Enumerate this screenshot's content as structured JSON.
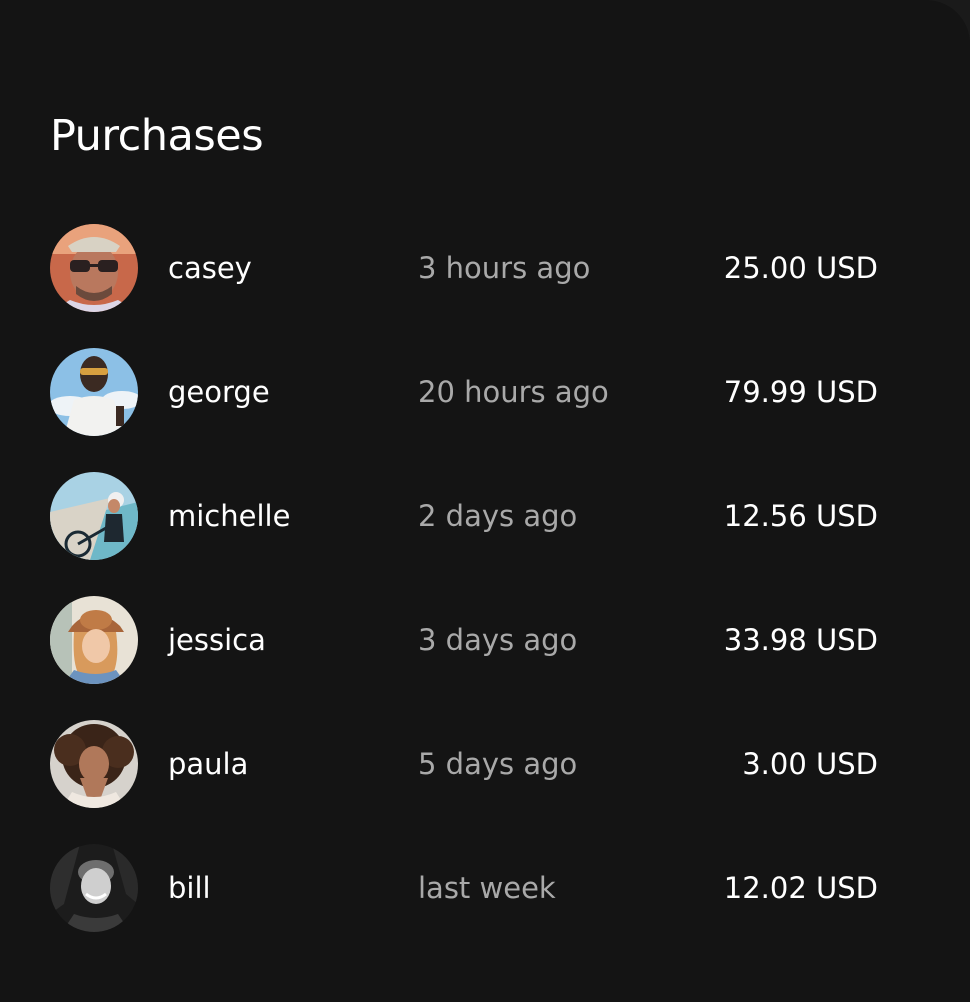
{
  "title": "Purchases",
  "purchases": [
    {
      "name": "casey",
      "time": "3 hours ago",
      "amount": "25.00 USD",
      "avatar_icon": "avatar-casey-icon"
    },
    {
      "name": "george",
      "time": "20 hours ago",
      "amount": "79.99 USD",
      "avatar_icon": "avatar-george-icon"
    },
    {
      "name": "michelle",
      "time": "2 days ago",
      "amount": "12.56 USD",
      "avatar_icon": "avatar-michelle-icon"
    },
    {
      "name": "jessica",
      "time": "3 days ago",
      "amount": "33.98 USD",
      "avatar_icon": "avatar-jessica-icon"
    },
    {
      "name": "paula",
      "time": "5 days ago",
      "amount": "3.00 USD",
      "avatar_icon": "avatar-paula-icon"
    },
    {
      "name": "bill",
      "time": "last week",
      "amount": "12.02 USD",
      "avatar_icon": "avatar-bill-icon"
    }
  ],
  "colors": {
    "background": "#141414",
    "text_primary": "#ffffff",
    "text_secondary": "#a9a9a9"
  }
}
